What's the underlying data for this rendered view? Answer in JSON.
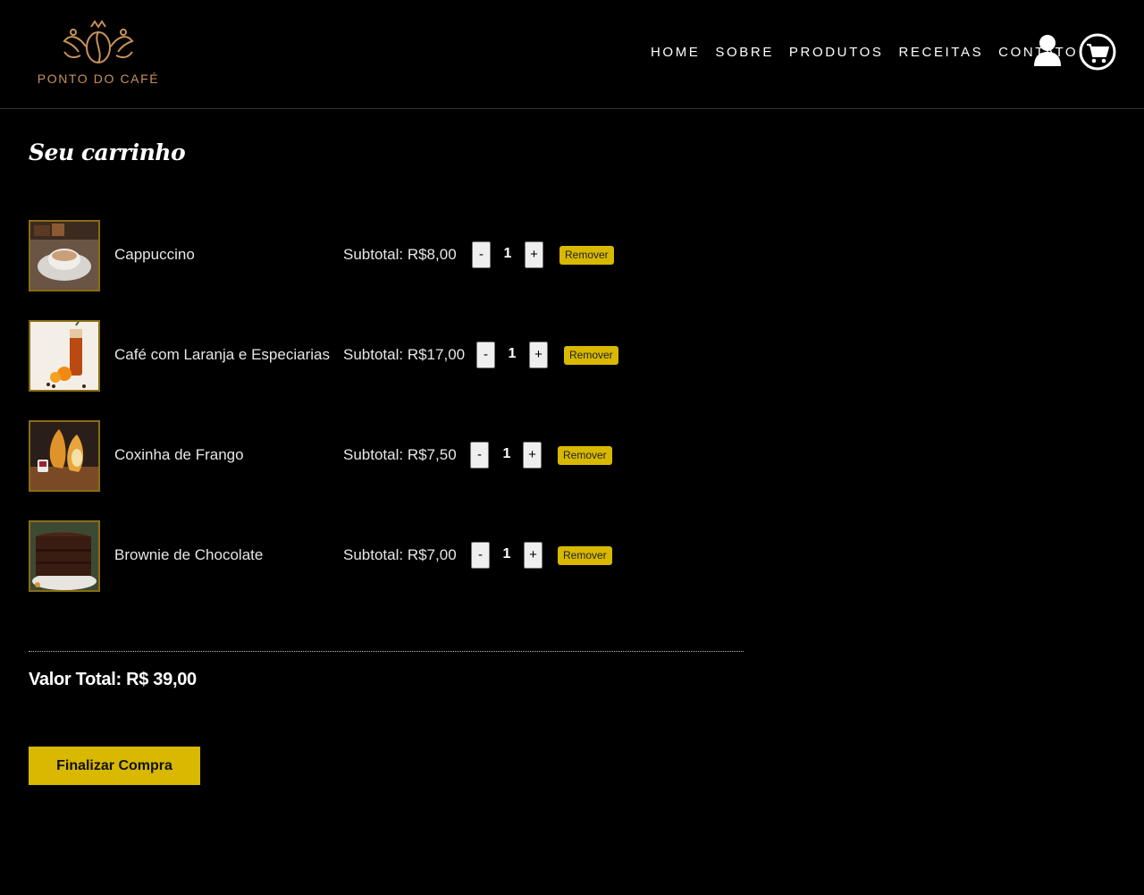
{
  "header": {
    "logo_text": "PONTO DO CAFÉ",
    "nav": [
      "HOME",
      "SOBRE",
      "PRODUTOS",
      "RECEITAS",
      "CONTATO"
    ],
    "icons": {
      "user": "user-icon",
      "cart": "cart-icon"
    }
  },
  "page": {
    "title": "Seu carrinho"
  },
  "cart": {
    "items": [
      {
        "name": "Cappuccino",
        "subtotal": "Subtotal: R$8,00",
        "quantity": "1",
        "remove_label": "Remover",
        "minus": "-",
        "plus": "+"
      },
      {
        "name": "Café com Laranja e Especiarias",
        "subtotal": "Subtotal: R$17,00",
        "quantity": "1",
        "remove_label": "Remover",
        "minus": "-",
        "plus": "+"
      },
      {
        "name": "Coxinha de Frango",
        "subtotal": "Subtotal: R$7,50",
        "quantity": "1",
        "remove_label": "Remover",
        "minus": "-",
        "plus": "+"
      },
      {
        "name": "Brownie de Chocolate",
        "subtotal": "Subtotal: R$7,00",
        "quantity": "1",
        "remove_label": "Remover",
        "minus": "-",
        "plus": "+"
      }
    ],
    "total": "Valor Total: R$ 39,00",
    "checkout_label": "Finalizar Compra"
  },
  "colors": {
    "background": "#000000",
    "accent": "#d8b800",
    "logo": "#c8915a",
    "thumb_border": "#8a6d12"
  }
}
